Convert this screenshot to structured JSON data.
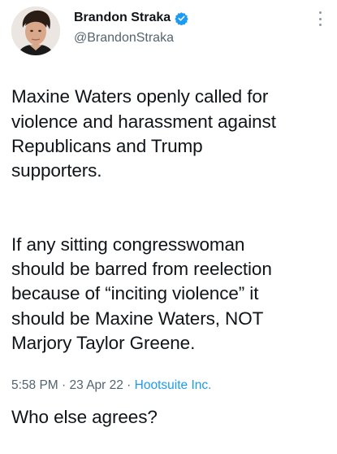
{
  "author": {
    "display_name": "Brandon Straka",
    "handle": "@BrandonStraka",
    "verified": true
  },
  "tweet": {
    "paragraphs": [
      "Maxine Waters openly called for\nviolence and harassment against\nRepublicans and Trump\nsupporters.",
      "If any sitting congresswoman\nshould be barred from reelection\nbecause of “inciting violence” it\nshould be Maxine Waters, NOT\nMarjory Taylor Greene.",
      "Who else agrees?"
    ]
  },
  "meta": {
    "time": "5:58 PM",
    "separator": " · ",
    "date": "23 Apr 22",
    "source": "Hootsuite Inc."
  },
  "colors": {
    "verified_badge": "#1d9bf0",
    "source_link": "#1d9bf0",
    "secondary_text": "#536471"
  },
  "icons": {
    "verified": "verified-badge-icon",
    "more": "more-options-icon"
  }
}
